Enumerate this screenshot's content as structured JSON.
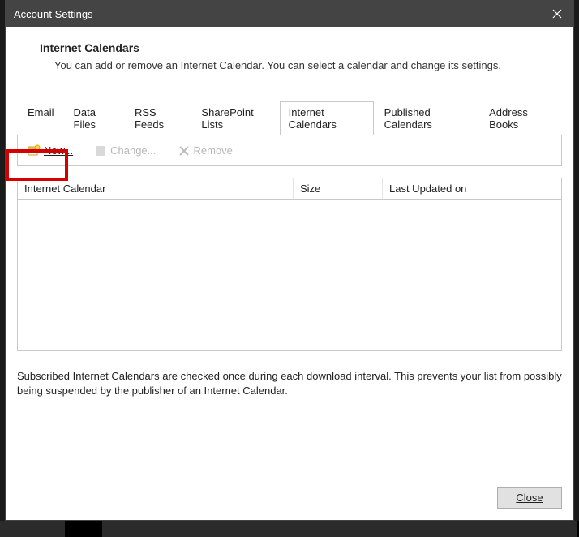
{
  "titlebar": {
    "title": "Account Settings"
  },
  "header": {
    "heading": "Internet Calendars",
    "subheading": "You can add or remove an Internet Calendar. You can select a calendar and change its settings."
  },
  "tabs": [
    {
      "label": "Email"
    },
    {
      "label": "Data Files"
    },
    {
      "label": "RSS Feeds"
    },
    {
      "label": "SharePoint Lists"
    },
    {
      "label": "Internet Calendars"
    },
    {
      "label": "Published Calendars"
    },
    {
      "label": "Address Books"
    }
  ],
  "toolbar": {
    "new_label": "New...",
    "change_label": "Change...",
    "remove_label": "Remove"
  },
  "grid": {
    "columns": {
      "name": "Internet Calendar",
      "size": "Size",
      "updated": "Last Updated on"
    },
    "rows": []
  },
  "note": "Subscribed Internet Calendars are checked once during each download interval. This prevents your list from possibly being suspended by the publisher of an Internet Calendar.",
  "footer": {
    "close_label": "Close"
  }
}
